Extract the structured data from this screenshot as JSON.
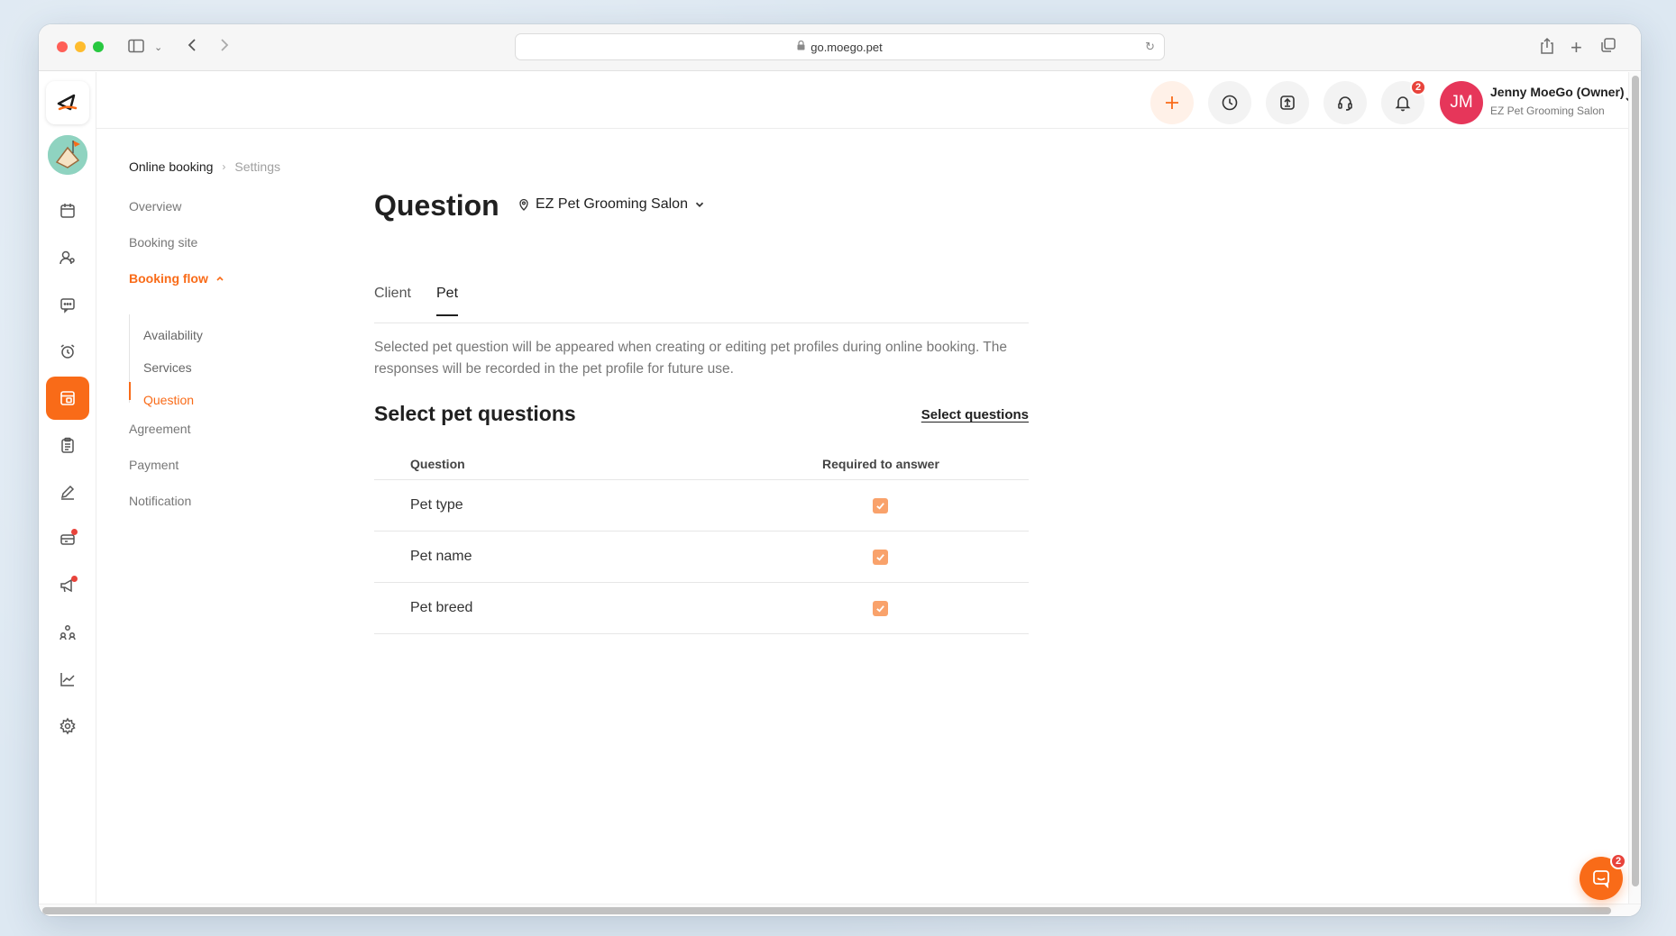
{
  "browser": {
    "url": "go.moego.pet"
  },
  "topbar": {
    "notification_count": "2",
    "user": {
      "initials": "JM",
      "name": "Jenny MoeGo (Owner)",
      "business": "EZ Pet Grooming Salon",
      "avatar_color": "#e6365a"
    }
  },
  "subnav": {
    "breadcrumb": {
      "root": "Online booking",
      "current": "Settings"
    },
    "items": [
      {
        "label": "Overview"
      },
      {
        "label": "Booking site"
      },
      {
        "label": "Booking flow"
      },
      {
        "label": "Agreement"
      },
      {
        "label": "Payment"
      },
      {
        "label": "Notification"
      }
    ],
    "booking_flow_children": [
      {
        "label": "Availability"
      },
      {
        "label": "Services"
      },
      {
        "label": "Question"
      }
    ]
  },
  "main": {
    "title": "Question",
    "location": "EZ Pet Grooming Salon",
    "tabs": [
      {
        "label": "Client"
      },
      {
        "label": "Pet"
      }
    ],
    "active_tab": "Pet",
    "description": "Selected pet question will be appeared when creating or editing pet profiles during online booking. The responses will be recorded in the pet profile for future use.",
    "section_title": "Select pet questions",
    "select_link": "Select questions",
    "table": {
      "headers": [
        "Question",
        "Required to answer"
      ],
      "rows": [
        {
          "question": "Pet type",
          "required": true
        },
        {
          "question": "Pet name",
          "required": true
        },
        {
          "question": "Pet breed",
          "required": true
        }
      ]
    }
  },
  "chat_widget": {
    "badge": "2"
  },
  "colors": {
    "accent": "#f96b18",
    "checkbox": "#f9a26b",
    "badge": "#e8433b"
  }
}
